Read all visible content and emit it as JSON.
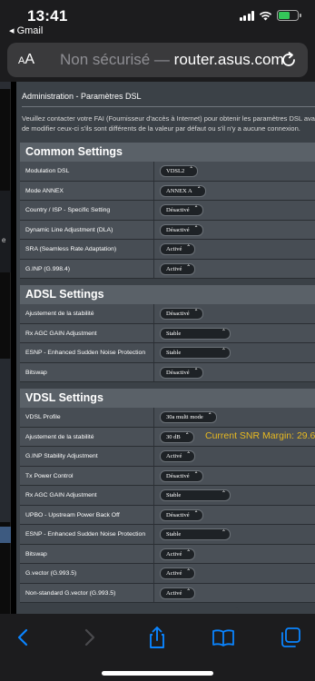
{
  "status": {
    "time": "13:41",
    "back_app": "◂ Gmail"
  },
  "browser": {
    "text_size_label": "AA",
    "not_secure": "Non sécurisé —",
    "domain": "router.asus.com"
  },
  "page": {
    "title": "Administration - Paramètres DSL",
    "description": "Veuillez contacter votre FAI (Fournisseur d'accès à Internet) pour obtenir les paramètres DSL avant de modifier ceux-ci s'ils sont différents de la valeur par défaut ou s'il n'y a aucune connexion. quelconque.",
    "left_edge_char": "e"
  },
  "common": {
    "title": "Common Settings",
    "rows": [
      {
        "label": "Modulation DSL",
        "value": "VDSL2"
      },
      {
        "label": "Mode ANNEX",
        "value": "ANNEX A"
      },
      {
        "label": "Country / ISP - Specific Setting",
        "value": "Désactivé"
      },
      {
        "label": "Dynamic Line Adjustment (DLA)",
        "value": "Désactivé"
      },
      {
        "label": "SRA (Seamless Rate Adaptation)",
        "value": "Activé"
      },
      {
        "label": "G.INP (G.998.4)",
        "value": "Activé"
      }
    ]
  },
  "adsl": {
    "title": "ADSL Settings",
    "rows": [
      {
        "label": "Ajustement de la stabilité",
        "value": "Désactivé"
      },
      {
        "label": "Rx AGC GAIN Adjustment",
        "value": "Stable"
      },
      {
        "label": "ESNP - Enhanced Sudden Noise Protection",
        "value": "Stable"
      },
      {
        "label": "Bitswap",
        "value": "Désactivé"
      }
    ]
  },
  "vdsl": {
    "title": "VDSL Settings",
    "rows": [
      {
        "label": "VDSL Profile",
        "value": "30a multi mode"
      },
      {
        "label": "Ajustement de la stabilité",
        "value": "30 dB"
      },
      {
        "label": "G.INP Stability Adjustment",
        "value": "Activé"
      },
      {
        "label": "Tx Power Control",
        "value": "Désactivé"
      },
      {
        "label": "Rx AGC GAIN Adjustment",
        "value": "Stable"
      },
      {
        "label": "UPBO - Upstream Power Back Off",
        "value": "Désactivé"
      },
      {
        "label": "ESNP - Enhanced Sudden Noise Protection",
        "value": "Stable"
      },
      {
        "label": "Bitswap",
        "value": "Activé"
      },
      {
        "label": "G.vector (G.993.5)",
        "value": "Activé"
      },
      {
        "label": "Non-standard G.vector (G.993.5)",
        "value": "Activé"
      }
    ],
    "snr_text": "Current SNR Margin: 29.6"
  },
  "toolbar_icons": [
    "back-icon",
    "forward-icon",
    "share-icon",
    "bookmarks-icon",
    "tabs-icon"
  ],
  "colors": {
    "accent": "#0a84ff",
    "snr": "#e8b920",
    "battery": "#34c759"
  }
}
